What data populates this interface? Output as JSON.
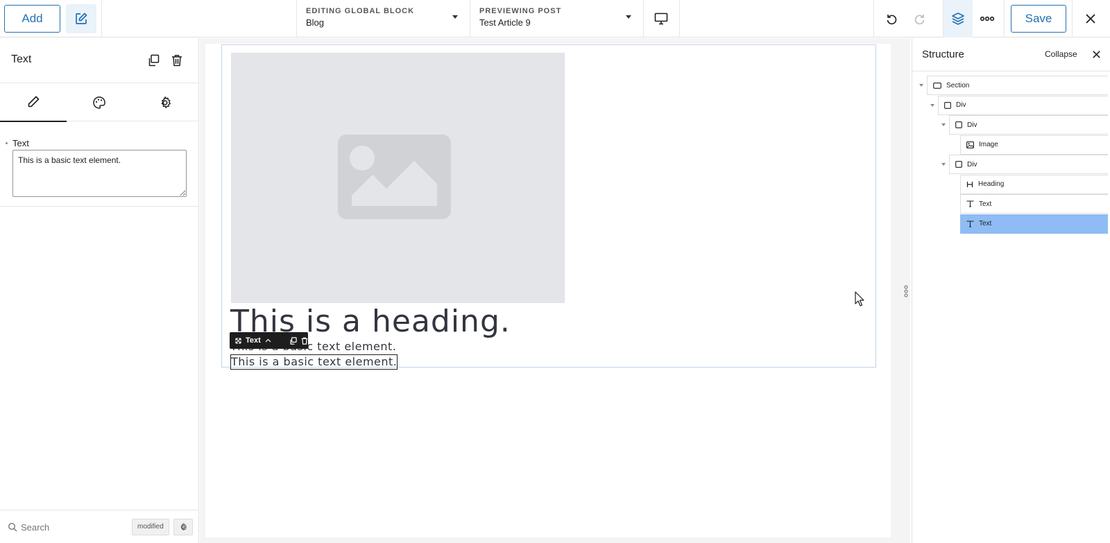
{
  "topbar": {
    "add_label": "Add",
    "editing_caption": "EDITING GLOBAL BLOCK",
    "editing_value": "Blog",
    "previewing_caption": "PREVIEWING POST",
    "previewing_value": "Test Article 9",
    "save_label": "Save",
    "accent": "#2271b1"
  },
  "left_panel": {
    "title": "Text",
    "field_label": "Text",
    "field_value": "This is a basic text element.",
    "search_placeholder": "Search",
    "modified_badge": "modified"
  },
  "canvas": {
    "heading": "This is a heading.",
    "text_1": "This is a basic text element.",
    "text_2": "This is a basic text element.",
    "toolbar_label": "Text"
  },
  "structure": {
    "title": "Structure",
    "collapse_label": "Collapse",
    "nodes": [
      {
        "label": "Section",
        "icon": "section-icon",
        "depth": 0
      },
      {
        "label": "Div",
        "icon": "div-icon",
        "depth": 1
      },
      {
        "label": "Div",
        "icon": "div-icon",
        "depth": 2
      },
      {
        "label": "Image",
        "icon": "image-icon",
        "depth": 3
      },
      {
        "label": "Div",
        "icon": "div-icon",
        "depth": 2
      },
      {
        "label": "Heading",
        "icon": "heading-icon",
        "depth": 3
      },
      {
        "label": "Text",
        "icon": "text-icon",
        "depth": 3
      },
      {
        "label": "Text",
        "icon": "text-icon",
        "depth": 3,
        "selected": true
      }
    ],
    "selected_color": "#8fbcf4"
  }
}
